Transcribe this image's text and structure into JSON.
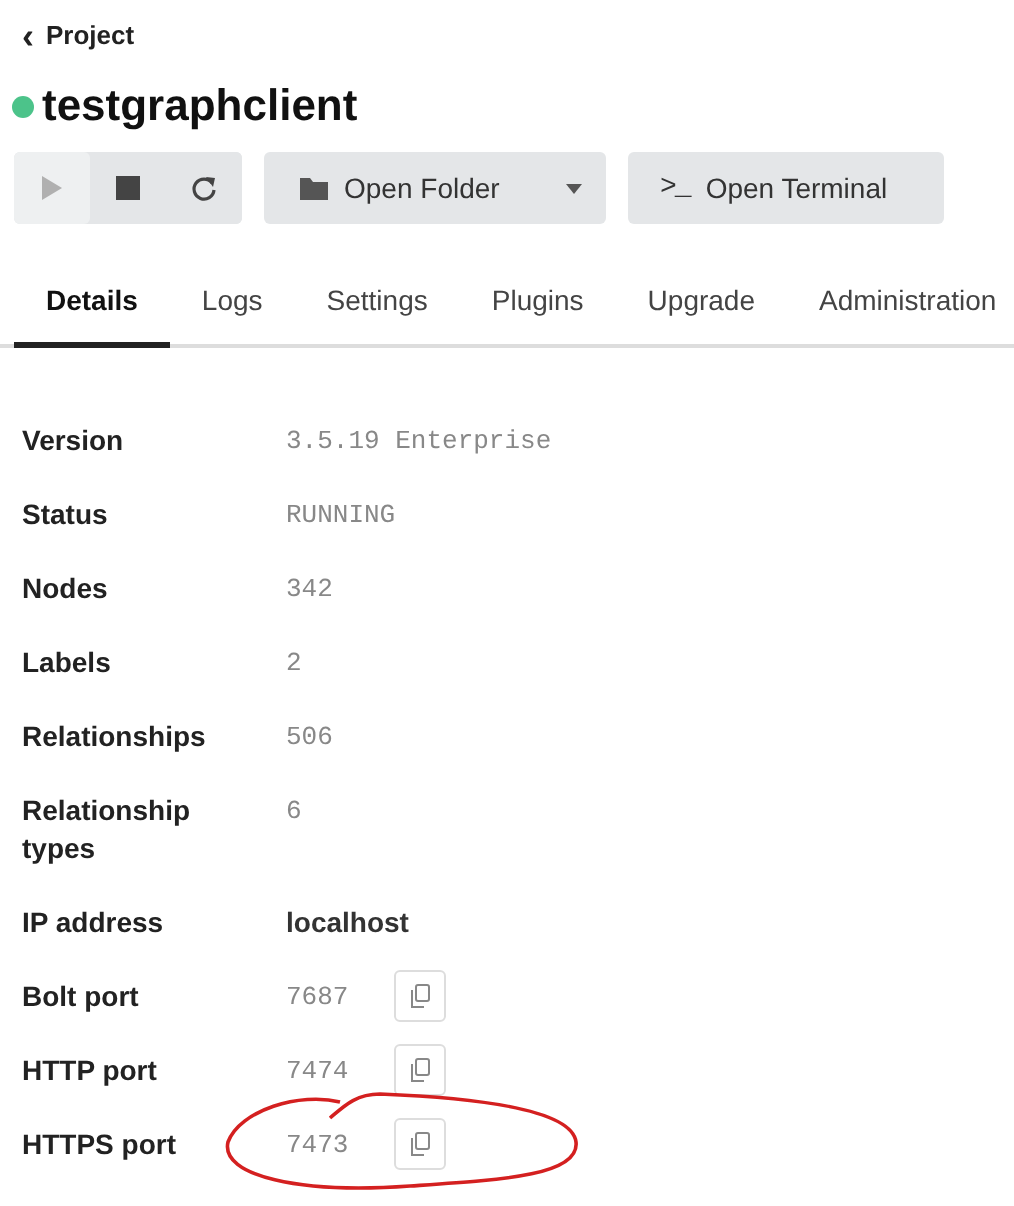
{
  "back_link": {
    "icon": "‹",
    "label": "Project"
  },
  "title": {
    "text": "testgraphclient",
    "online": true
  },
  "toolbar": {
    "controls": [
      {
        "kind": "play",
        "disabled": true
      },
      {
        "kind": "stop",
        "disabled": false
      },
      {
        "kind": "restart",
        "disabled": false
      }
    ],
    "folder_button": {
      "label": "Open Folder"
    },
    "terminal_button": {
      "icon": ">_",
      "label": "Open Terminal"
    }
  },
  "tabs": [
    {
      "label": "Details",
      "selected": true
    },
    {
      "label": "Logs",
      "selected": false
    },
    {
      "label": "Settings",
      "selected": false
    },
    {
      "label": "Plugins",
      "selected": false
    },
    {
      "label": "Upgrade",
      "selected": false
    },
    {
      "label": "Administration",
      "selected": false
    }
  ],
  "details": [
    {
      "label": "Version",
      "value": "3.5.19 Enterprise",
      "kind": "mono",
      "copyable": false
    },
    {
      "label": "Status",
      "value": "RUNNING",
      "kind": "mono",
      "copyable": false
    },
    {
      "label": "Nodes",
      "value": "342",
      "kind": "mono",
      "copyable": false
    },
    {
      "label": "Labels",
      "value": "2",
      "kind": "mono",
      "copyable": false
    },
    {
      "label": "Relationships",
      "value": "506",
      "kind": "mono",
      "copyable": false
    },
    {
      "label": "Relationship types",
      "value": "6",
      "kind": "mono",
      "copyable": false
    },
    {
      "label": "IP address",
      "value": "localhost",
      "kind": "plain",
      "copyable": false
    },
    {
      "label": "Bolt port",
      "value": "7687",
      "kind": "mono",
      "copyable": true
    },
    {
      "label": "HTTP port",
      "value": "7474",
      "kind": "mono",
      "copyable": true
    },
    {
      "label": "HTTPS port",
      "value": "7473",
      "kind": "mono",
      "copyable": true,
      "circled": true
    }
  ]
}
